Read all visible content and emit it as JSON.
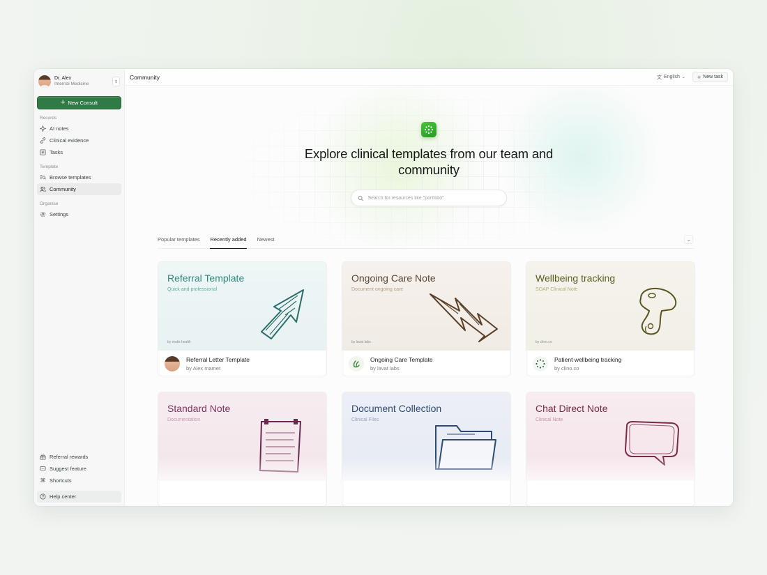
{
  "user": {
    "name": "Dr. Alex",
    "role": "Internal Medicine"
  },
  "sidebar": {
    "new_consult": "New Consult",
    "sections": {
      "records": "Records",
      "template": "Template",
      "organise": "Organise"
    },
    "items": {
      "ai_notes": "AI notes",
      "clinical_evidence": "Clinical evidence",
      "tasks": "Tasks",
      "browse_templates": "Browse templates",
      "community": "Community",
      "settings": "Settings",
      "referral_rewards": "Referral rewards",
      "suggest_feature": "Suggest feature",
      "shortcuts": "Shortcuts",
      "help_center": "Help center"
    }
  },
  "topbar": {
    "title": "Community",
    "language": "English",
    "new_task": "New task"
  },
  "hero": {
    "title": "Explore clinical templates from our team and community",
    "search_placeholder": "Search for resources like \"portfolio\""
  },
  "tabs": [
    "Popular templates",
    "Recently added",
    "Newest"
  ],
  "active_tab": "Recently added",
  "cards": [
    {
      "title": "Referral Template",
      "subtitle": "Quick and professional",
      "by": "by matix health",
      "name": "Referral Letter Template",
      "author": "by Alex mamet",
      "color": "#2f8a7c",
      "bg": "#edf5f5"
    },
    {
      "title": "Ongoing Care Note",
      "subtitle": "Document ongoing care",
      "by": "by lavat labs",
      "name": "Ongoing Care Template",
      "author": "by lavat labs",
      "color": "#6b5440",
      "bg": "#f5f0ec"
    },
    {
      "title": "Wellbeing tracking",
      "subtitle": "SOAP Clinical Note",
      "by": "by clino.co",
      "name": "Patient wellbeing tracking",
      "author": "by clino.co",
      "color": "#6b6a2a",
      "bg": "#f4f2ea"
    },
    {
      "title": "Standard Note",
      "subtitle": "Documentation",
      "color": "#8a3a66",
      "bg": "#f6ecf0"
    },
    {
      "title": "Document Collection",
      "subtitle": "Clinical Files",
      "color": "#2f4f78",
      "bg": "#eceff5"
    },
    {
      "title": "Chat Direct Note",
      "subtitle": "Clinical Note",
      "color": "#8a2f52",
      "bg": "#f7ecef"
    }
  ]
}
